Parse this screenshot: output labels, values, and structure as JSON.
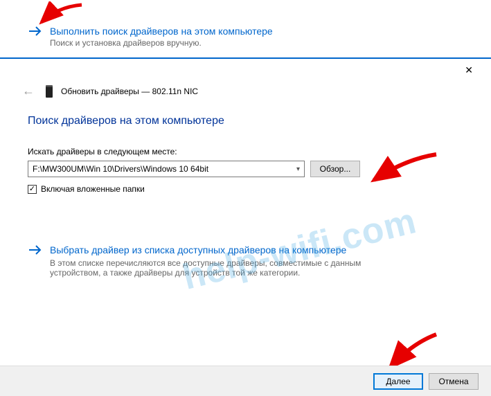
{
  "top_option": {
    "title": "Выполнить поиск драйверов на этом компьютере",
    "subtitle": "Поиск и установка драйверов вручную."
  },
  "dialog": {
    "header": "Обновить драйверы — 802.11n NIC",
    "section_title": "Поиск драйверов на этом компьютере",
    "field_label": "Искать драйверы в следующем месте:",
    "path_value": "F:\\MW300UM\\Win 10\\Drivers\\Windows 10 64bit",
    "browse_label": "Обзор...",
    "include_subfolders_label": "Включая вложенные папки",
    "include_subfolders_checked": true,
    "link_option": {
      "title": "Выбрать драйвер из списка доступных драйверов на компьютере",
      "desc": "В этом списке перечисляются все доступные драйверы, совместимые с данным устройством, а также драйверы для устройств той же категории."
    },
    "buttons": {
      "next": "Далее",
      "cancel": "Отмена"
    },
    "close_symbol": "✕"
  },
  "watermark": "help-wifi.com"
}
